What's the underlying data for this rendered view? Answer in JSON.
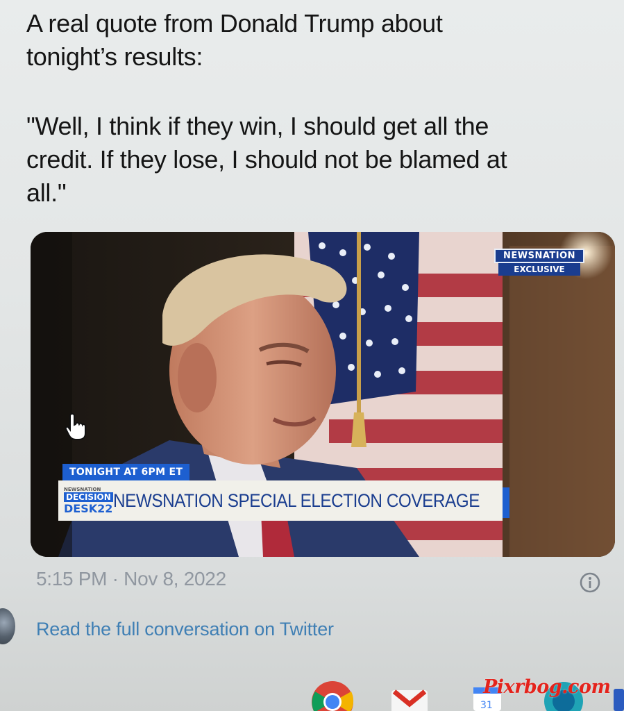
{
  "tweet": {
    "line_1": "A real quote from Donald Trump about",
    "line_2": "tonight’s results:",
    "quote_line_1": "\"Well, I think if they win, I should get all the",
    "quote_line_2": "credit. If they lose, I should not be blamed at",
    "quote_line_3": "all.\""
  },
  "video": {
    "badge_brand": "NEWSNATION",
    "badge_label": "EXCLUSIVE",
    "tonight_banner": "TONIGHT AT 6PM ET",
    "logo_small": "NEWSNATION",
    "logo_decision": "DECISION",
    "logo_desk": "DESK22",
    "headline": "NEWSNATION SPECIAL ELECTION COVERAGE"
  },
  "meta": {
    "timestamp": "5:15 PM · Nov 8, 2022",
    "read_more": "Read the full conversation on Twitter"
  },
  "dock": {
    "icons": [
      "chrome-icon",
      "gmail-icon",
      "calendar-icon",
      "browser-icon"
    ],
    "calendar_day": "31"
  },
  "watermark": "Pixrbog.com",
  "colors": {
    "text": "#151515",
    "timestamp": "#9097a0",
    "link": "#3f7fb4",
    "newsnation_blue": "#1d5fd0",
    "watermark": "#e4231c"
  }
}
